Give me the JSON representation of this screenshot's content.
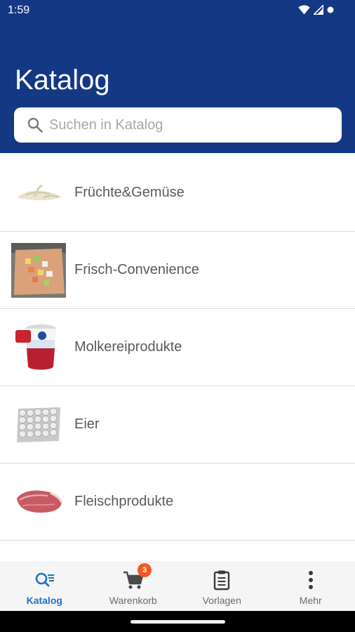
{
  "status_bar": {
    "time": "1:59",
    "icons": [
      "wifi-icon",
      "signal-icon",
      "notification-dot-icon"
    ]
  },
  "header": {
    "title": "Katalog",
    "background_color": "#153885"
  },
  "search": {
    "placeholder": "Suchen in Katalog",
    "value": "",
    "icon": "search-icon"
  },
  "categories": [
    {
      "label": "Früchte&Gemüse",
      "thumbnail": "vegetable-photo"
    },
    {
      "label": "Frisch-Convenience",
      "thumbnail": "cutting-board-photo"
    },
    {
      "label": "Molkereiprodukte",
      "thumbnail": "yogurt-cup-photo"
    },
    {
      "label": "Eier",
      "thumbnail": "egg-tray-photo"
    },
    {
      "label": "Fleischprodukte",
      "thumbnail": "meat-photo"
    }
  ],
  "bottom_nav": {
    "items": [
      {
        "label": "Katalog",
        "icon": "catalog-search-icon",
        "active": true
      },
      {
        "label": "Warenkorb",
        "icon": "cart-icon",
        "active": false
      },
      {
        "label": "Vorlagen",
        "icon": "clipboard-icon",
        "active": false
      },
      {
        "label": "Mehr",
        "icon": "more-vertical-icon",
        "active": false
      }
    ],
    "cart_badge": "3",
    "active_color": "#1a73c9",
    "badge_color": "#f05a22"
  }
}
